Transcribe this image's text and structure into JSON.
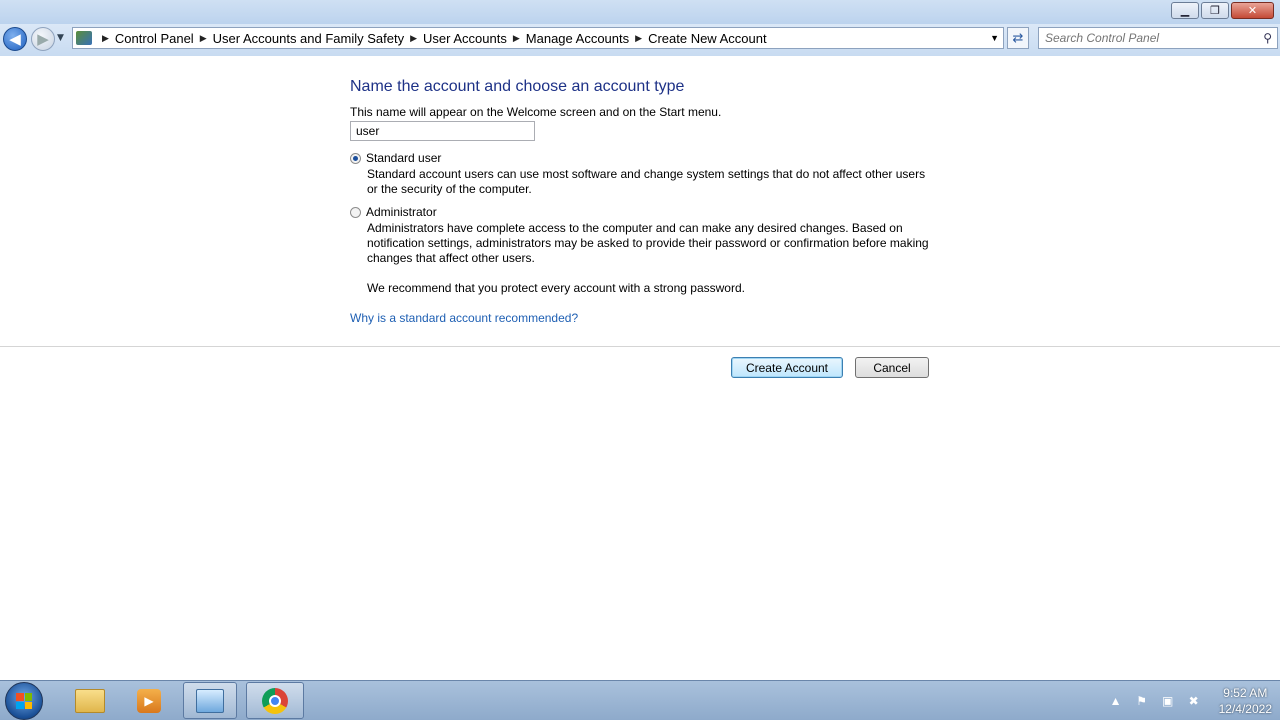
{
  "window": {
    "minimize_glyph": "▁",
    "maximize_glyph": "❐",
    "close_glyph": "✕"
  },
  "navigation": {
    "breadcrumbs": [
      "Control Panel",
      "User Accounts and Family Safety",
      "User Accounts",
      "Manage Accounts",
      "Create New Account"
    ],
    "search_placeholder": "Search Control Panel"
  },
  "form": {
    "heading": "Name the account and choose an account type",
    "subtitle": "This name will appear on the Welcome screen and on the Start menu.",
    "name_value": "user",
    "options": [
      {
        "label": "Standard user",
        "selected": true,
        "description": "Standard account users can use most software and change system settings that do not affect other users or the security of the computer."
      },
      {
        "label": "Administrator",
        "selected": false,
        "description": "Administrators have complete access to the computer and can make any desired changes. Based on notification settings, administrators may be asked to provide their password or confirmation before making changes that affect other users."
      }
    ],
    "recommendation": "We recommend that you protect every account with a strong password.",
    "help_link": "Why is a standard account recommended?",
    "create_button": "Create Account",
    "cancel_button": "Cancel"
  },
  "taskbar": {
    "pinned": [
      "windows-explorer-icon",
      "media-player-icon",
      "control-panel-icon",
      "chrome-icon"
    ],
    "time": "9:52 AM",
    "date": "12/4/2022"
  }
}
